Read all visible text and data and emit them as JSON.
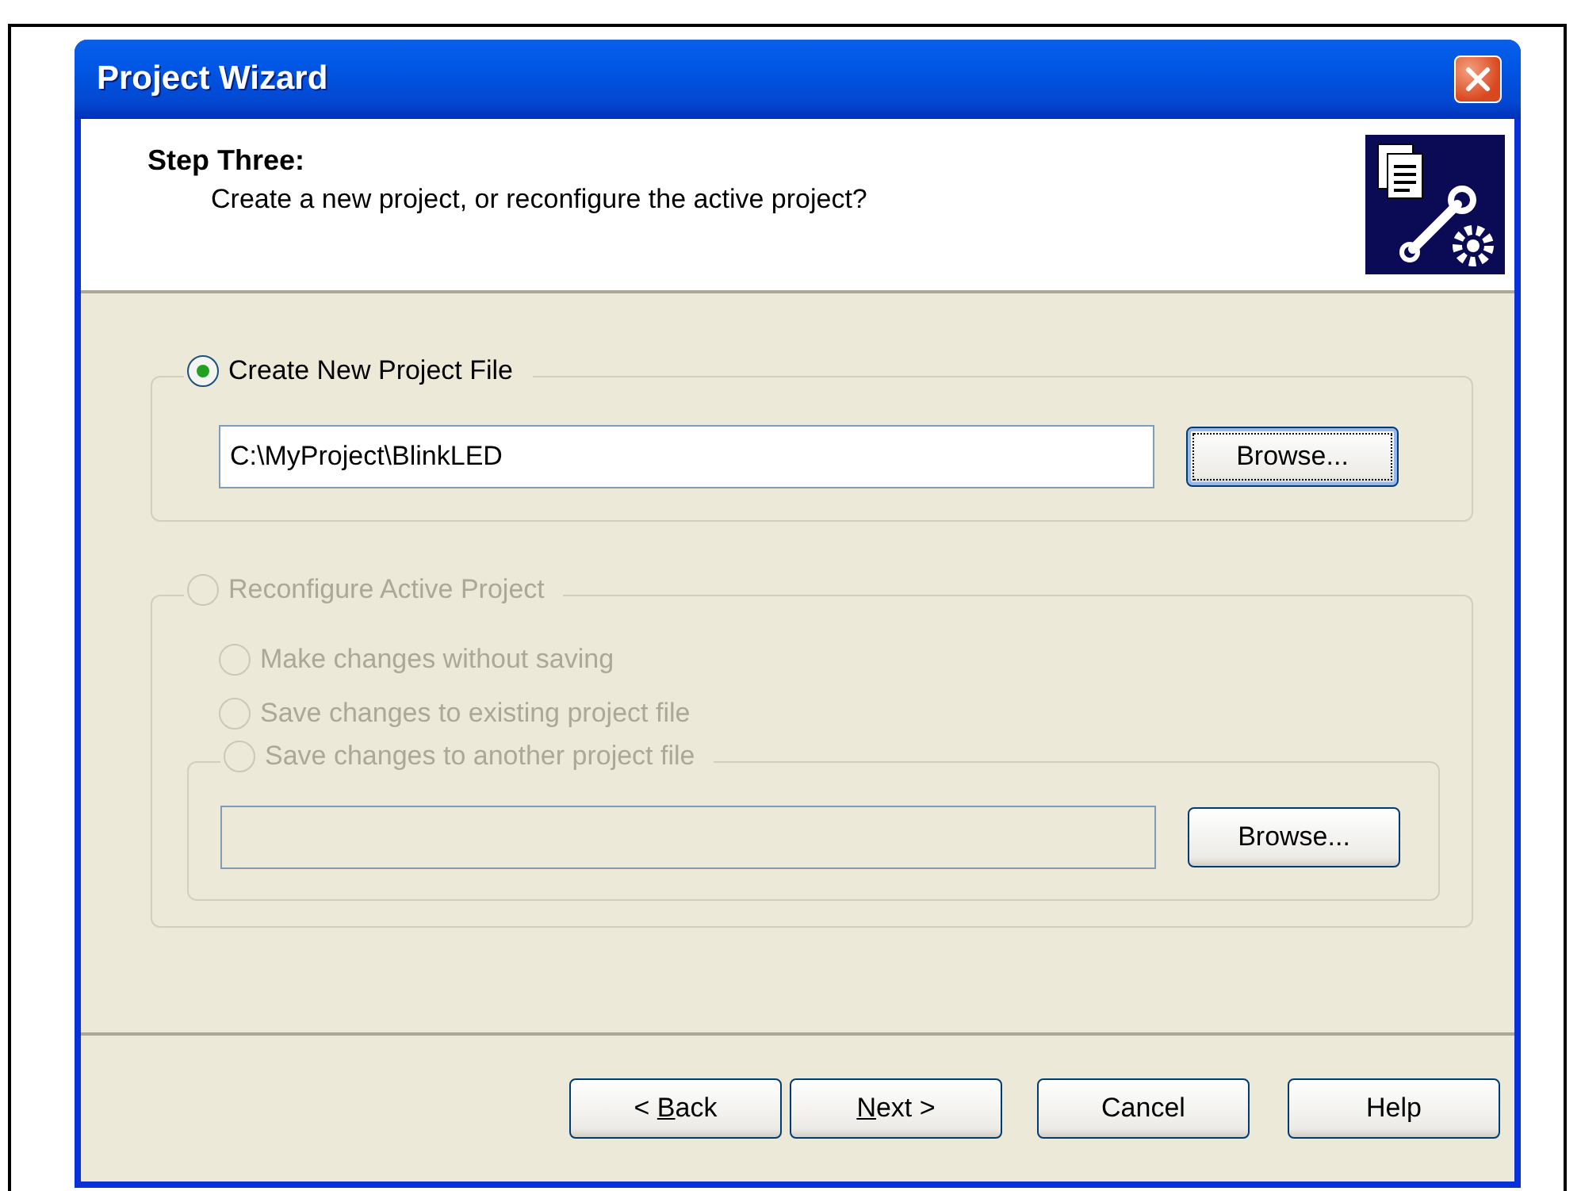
{
  "window": {
    "title": "Project Wizard"
  },
  "header": {
    "step": "Step Three:",
    "question": "Create a new project, or reconfigure the active project?"
  },
  "create_group": {
    "option": {
      "label": "Create New Project File",
      "selected": true,
      "disabled": false
    },
    "path_field": {
      "value": "C:\\MyProject\\BlinkLED",
      "disabled": false
    },
    "browse_button": {
      "label": "Browse...",
      "focused": true,
      "disabled": false
    }
  },
  "reconfigure_group": {
    "option": {
      "label": "Reconfigure Active Project",
      "selected": false,
      "disabled": true
    },
    "sub_options": [
      {
        "label": "Make changes without saving",
        "selected": false,
        "disabled": true
      },
      {
        "label": "Save changes to existing project file",
        "selected": false,
        "disabled": true
      }
    ],
    "another_file": {
      "option": {
        "label": "Save changes to another project file",
        "selected": false,
        "disabled": true
      },
      "path_field": {
        "disabled": true
      },
      "browse_button": {
        "label": "Browse...",
        "focused": false,
        "disabled": false
      }
    }
  },
  "buttons": [
    {
      "before": "< ",
      "accel": "B",
      "after": "ack"
    },
    {
      "accel": "N",
      "after": "ext >"
    },
    {
      "before": "Cancel"
    },
    {
      "before": "Help"
    }
  ]
}
